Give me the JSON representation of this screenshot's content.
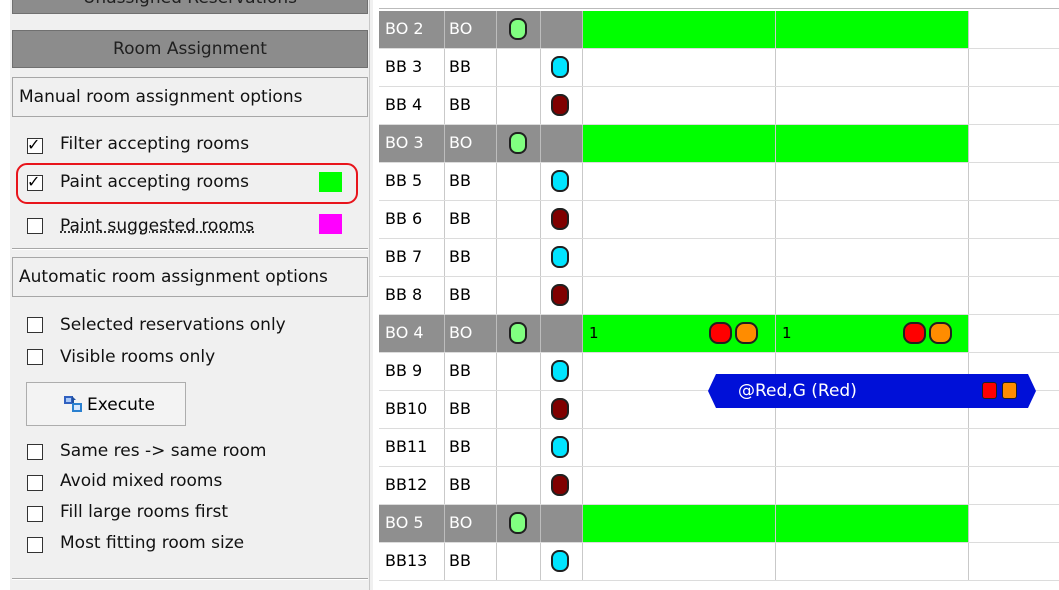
{
  "panel": {
    "unassigned_tab": "Unassigned Reservations",
    "room_assignment_header": "Room Assignment",
    "manual_section_title": "Manual room assignment options",
    "manual_options": [
      {
        "label": "Filter accepting rooms",
        "checked": true
      },
      {
        "label": "Paint accepting rooms",
        "checked": true,
        "swatch": "#00ff00"
      },
      {
        "label": "Paint suggested rooms",
        "checked": false,
        "swatch": "#ff00ff"
      }
    ],
    "auto_section_title": "Automatic room assignment options",
    "auto_options": [
      {
        "label": "Selected reservations only",
        "checked": false
      },
      {
        "label": "Visible rooms only",
        "checked": false
      }
    ],
    "execute_label": "Execute",
    "extra_options": [
      {
        "label": "Same res -> same room",
        "checked": false
      },
      {
        "label": "Avoid mixed rooms",
        "checked": false
      },
      {
        "label": "Fill large rooms first",
        "checked": false
      },
      {
        "label": "Most fitting room size",
        "checked": false
      }
    ]
  },
  "grid": {
    "rows": [
      {
        "name": "BO 2",
        "type": "BO",
        "kind": "bo",
        "status": "green",
        "paint": true
      },
      {
        "name": "BB 3",
        "type": "BB",
        "kind": "bb",
        "status": "cyan"
      },
      {
        "name": "BB 4",
        "type": "BB",
        "kind": "bb",
        "status": "maroon"
      },
      {
        "name": "BO 3",
        "type": "BO",
        "kind": "bo",
        "status": "green",
        "paint": true
      },
      {
        "name": "BB 5",
        "type": "BB",
        "kind": "bb",
        "status": "cyan"
      },
      {
        "name": "BB 6",
        "type": "BB",
        "kind": "bb",
        "status": "maroon"
      },
      {
        "name": "BB 7",
        "type": "BB",
        "kind": "bb",
        "status": "cyan"
      },
      {
        "name": "BB 8",
        "type": "BB",
        "kind": "bb",
        "status": "maroon"
      },
      {
        "name": "BO 4",
        "type": "BO",
        "kind": "bo",
        "status": "green",
        "paint": true,
        "counts": [
          "1",
          "1"
        ]
      },
      {
        "name": "BB 9",
        "type": "BB",
        "kind": "bb",
        "status": "cyan"
      },
      {
        "name": "BB10",
        "type": "BB",
        "kind": "bb",
        "status": "maroon"
      },
      {
        "name": "BB11",
        "type": "BB",
        "kind": "bb",
        "status": "cyan"
      },
      {
        "name": "BB12",
        "type": "BB",
        "kind": "bb",
        "status": "maroon"
      },
      {
        "name": "BO 5",
        "type": "BO",
        "kind": "bo",
        "status": "green",
        "paint": true
      },
      {
        "name": "BB13",
        "type": "BB",
        "kind": "bb",
        "status": "cyan"
      }
    ],
    "reservation": {
      "label": "@Red,G (Red)",
      "color": "#0010d8"
    }
  }
}
